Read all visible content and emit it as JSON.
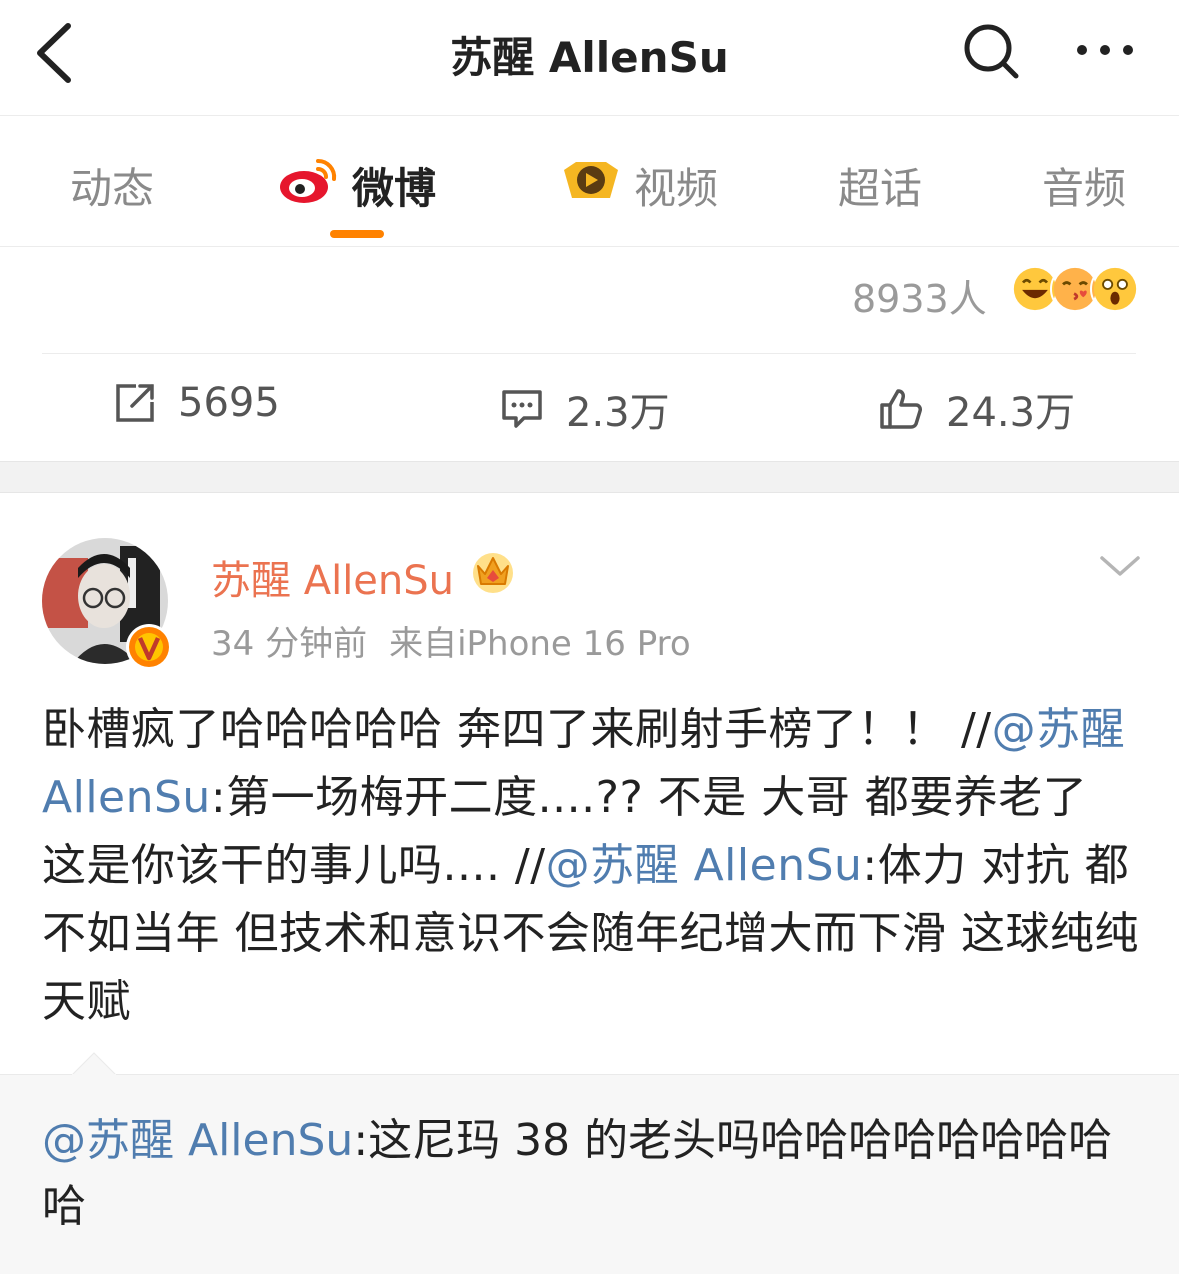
{
  "header": {
    "title": "苏醒 AllenSu",
    "back_icon": "chevron-left-icon",
    "search_icon": "search-icon",
    "more_icon": "more-dots-icon"
  },
  "tabs": [
    {
      "label": "动态",
      "active": false
    },
    {
      "label": "微博",
      "active": true,
      "icon": "weibo-logo-icon"
    },
    {
      "label": "视频",
      "active": false,
      "icon": "video-play-icon"
    },
    {
      "label": "超话",
      "active": false
    },
    {
      "label": "音频",
      "active": false
    }
  ],
  "accent_color": "#ff8200",
  "previous_post": {
    "reaction_count": "8933人",
    "emojis": [
      "laughing-emoji",
      "kiss-emoji",
      "shocked-emoji"
    ],
    "repost_count": "5695",
    "comment_count": "2.3万",
    "like_count": "24.3万"
  },
  "post": {
    "author": "苏醒 AllenSu",
    "time": "34 分钟前",
    "source": "来自iPhone 16 Pro",
    "body_1": "卧槽疯了哈哈哈哈哈 奔四了来刷射手榜了！！ //",
    "mention_1": "@苏醒 AllenSu",
    "body_2": ":第一场梅开二度....?? 不是 大哥 都要养老了 这是你该干的事儿吗.... //",
    "mention_2": "@苏醒 AllenSu",
    "body_3": ":体力 对抗 都不如当年 但技术和意识不会随年纪增大而下滑 这球纯纯天赋"
  },
  "repost": {
    "mention": "@苏醒 AllenSu",
    "text": ":这尼玛 38 的老头吗哈哈哈哈哈哈哈哈哈"
  }
}
